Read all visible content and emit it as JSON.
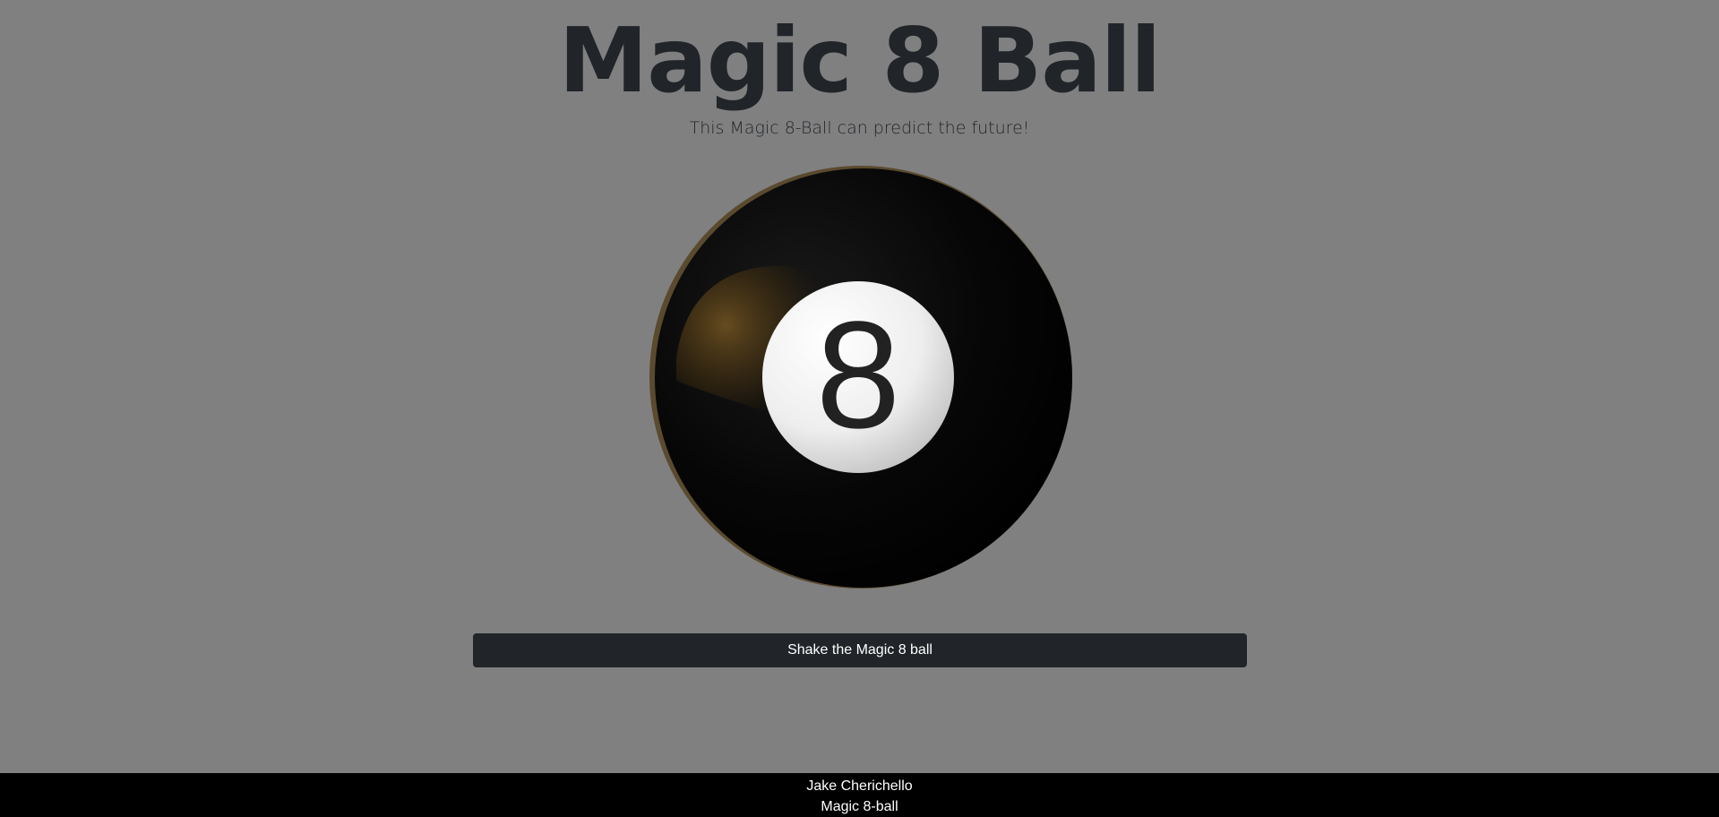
{
  "header": {
    "title": "Magic 8 Ball",
    "subtitle": "This Magic 8-Ball can predict the future!"
  },
  "ball": {
    "number": "8",
    "icon": "magic-8-ball-icon"
  },
  "actions": {
    "shake_label": "Shake the Magic 8 ball"
  },
  "footer": {
    "author": "Jake Cherichello",
    "project": "Magic 8-ball"
  },
  "colors": {
    "background": "#808080",
    "title_text": "#212529",
    "button_bg": "#212529",
    "footer_bg": "#000000",
    "ball_body": "#050505",
    "ball_highlight": "#6b4f20"
  }
}
